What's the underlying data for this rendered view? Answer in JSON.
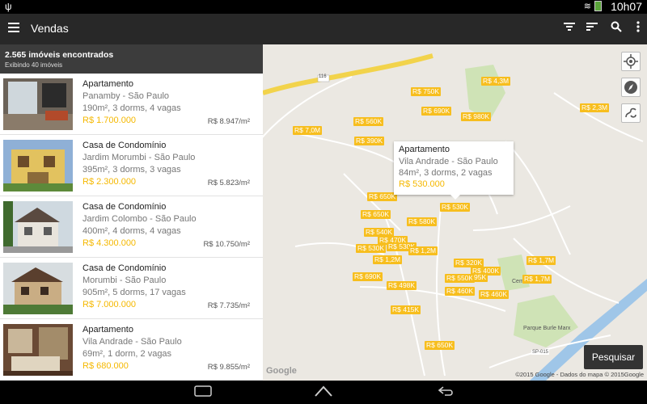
{
  "status_bar": {
    "time": "10h07"
  },
  "app_bar": {
    "title": "Vendas"
  },
  "summary": {
    "count": "2.565 imóveis encontrados",
    "showing": "Exibindo 40 imóveis"
  },
  "listings": [
    {
      "type": "Apartamento",
      "location": "Panamby - São Paulo",
      "features": "190m², 3 dorms, 4 vagas",
      "price": "R$ 1.700.000",
      "price_m2": "R$ 8.947/m²"
    },
    {
      "type": "Casa de Condomínio",
      "location": "Jardim Morumbi - São Paulo",
      "features": "395m², 3 dorms, 3 vagas",
      "price": "R$ 2.300.000",
      "price_m2": "R$ 5.823/m²"
    },
    {
      "type": "Casa de Condomínio",
      "location": "Jardim Colombo - São Paulo",
      "features": "400m², 4 dorms, 4 vagas",
      "price": "R$ 4.300.000",
      "price_m2": "R$ 10.750/m²"
    },
    {
      "type": "Casa de Condomínio",
      "location": "Morumbi - São Paulo",
      "features": "905m², 5 dorms, 17 vagas",
      "price": "R$ 7.000.000",
      "price_m2": "R$ 7.735/m²"
    },
    {
      "type": "Apartamento",
      "location": "Vila Andrade - São Paulo",
      "features": "69m², 1 dorm, 2 vagas",
      "price": "R$ 680.000",
      "price_m2": "R$ 9.855/m²"
    }
  ],
  "map": {
    "pins": [
      "R$ 4,3M",
      "R$ 750K",
      "R$ 2,3M",
      "R$ 690K",
      "R$ 980K",
      "R$ 560K",
      "R$ 7,0M",
      "R$ 390K",
      "R$ 650K",
      "R$ 650K",
      "R$ 530K",
      "R$ 580K",
      "R$ 540K",
      "R$ 470K",
      "R$ 530K",
      "R$ 530K",
      "R$ 1,2M",
      "R$ 1,2M",
      "R$ 320K",
      "R$ 1,7M",
      "R$ 690K",
      "R$ 400K",
      "R$ 550K",
      "95K",
      "R$ 1,7M",
      "R$ 498K",
      "R$ 460K",
      "R$ 460K",
      "R$ 415K",
      "R$ 650K"
    ],
    "callout": {
      "type": "Apartamento",
      "location": "Vila Andrade - São Paulo",
      "features": "84m², 3 dorms, 2 vagas",
      "price": "R$ 530.000"
    },
    "search_label": "Pesquisar",
    "google_logo": "Google",
    "copyright": "©2015 Google - Dados do mapa © 2015Google",
    "labels": [
      "116",
      "Cemitério do M",
      "Parque Burle Marx",
      "SP-015"
    ]
  }
}
